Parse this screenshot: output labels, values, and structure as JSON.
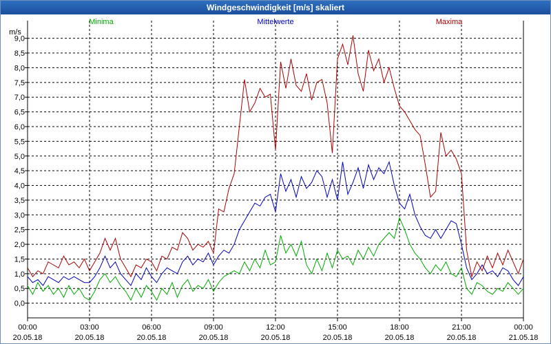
{
  "title": "Windgeschwindigkeit [m/s] skaliert",
  "chart_data": {
    "type": "line",
    "title": "Windgeschwindigkeit [m/s] skaliert",
    "ylabel": "m/s",
    "xlabel": "",
    "ylim": [
      -0.5,
      9.6
    ],
    "xlim": [
      0,
      24
    ],
    "grid": true,
    "legend_position": "top",
    "yticks": [
      "0,0",
      "0,5",
      "1,0",
      "1,5",
      "2,0",
      "2,5",
      "3,0",
      "3,5",
      "4,0",
      "4,5",
      "5,0",
      "5,5",
      "6,0",
      "6,5",
      "7,0",
      "7,5",
      "8,0",
      "8,5",
      "9,0"
    ],
    "xticks": [
      {
        "time": "00:00",
        "date": "20.05.18"
      },
      {
        "time": "03:00",
        "date": "20.05.18"
      },
      {
        "time": "06:00",
        "date": "20.05.18"
      },
      {
        "time": "09:00",
        "date": "20.05.18"
      },
      {
        "time": "12:00",
        "date": "20.05.18"
      },
      {
        "time": "15:00",
        "date": "20.05.18"
      },
      {
        "time": "18:00",
        "date": "20.05.18"
      },
      {
        "time": "21:00",
        "date": "20.05.18"
      },
      {
        "time": "00:00",
        "date": "21.05.18"
      }
    ],
    "series": [
      {
        "name": "Minima",
        "color": "#00aa00",
        "x": [
          0,
          0.25,
          0.5,
          0.75,
          1,
          1.25,
          1.5,
          1.75,
          2,
          2.25,
          2.5,
          2.75,
          3,
          3.25,
          3.5,
          3.75,
          4,
          4.25,
          4.5,
          4.75,
          5,
          5.25,
          5.5,
          5.75,
          6,
          6.25,
          6.5,
          6.75,
          7,
          7.25,
          7.5,
          7.75,
          8,
          8.25,
          8.5,
          8.75,
          9,
          9.25,
          9.5,
          9.75,
          10,
          10.25,
          10.5,
          10.75,
          11,
          11.25,
          11.5,
          11.75,
          12,
          12.25,
          12.5,
          12.75,
          13,
          13.25,
          13.5,
          13.75,
          14,
          14.25,
          14.5,
          14.75,
          15,
          15.25,
          15.5,
          15.75,
          16,
          16.25,
          16.5,
          16.75,
          17,
          17.25,
          17.5,
          17.75,
          18,
          18.25,
          18.5,
          18.75,
          19,
          19.25,
          19.5,
          19.75,
          20,
          20.25,
          20.5,
          20.75,
          21,
          21.25,
          21.5,
          21.75,
          22,
          22.25,
          22.5,
          22.75,
          23,
          23.25,
          23.5,
          23.75,
          24
        ],
        "y": [
          0.6,
          0.3,
          0.7,
          0.4,
          0.6,
          0.3,
          0.5,
          0.2,
          0.6,
          0.3,
          0.5,
          0.2,
          0.1,
          0.4,
          0.8,
          1.0,
          0.7,
          0.9,
          0.6,
          0.4,
          0.1,
          0.5,
          0.2,
          0.6,
          0.4,
          0.1,
          0.5,
          0.3,
          0.7,
          0.2,
          0.6,
          0.8,
          0.4,
          0.6,
          0.5,
          0.8,
          0.4,
          0.7,
          0.9,
          1.0,
          1.1,
          1.0,
          1.4,
          1.1,
          1.5,
          1.2,
          1.8,
          1.3,
          1.4,
          2.3,
          1.7,
          2.0,
          1.6,
          2.1,
          1.3,
          1.0,
          1.5,
          1.1,
          1.7,
          1.2,
          1.8,
          1.5,
          1.6,
          1.3,
          1.8,
          1.5,
          1.9,
          1.6,
          2.0,
          2.2,
          2.4,
          2.2,
          2.9,
          2.5,
          2.0,
          1.7,
          1.5,
          1.2,
          1.0,
          1.3,
          1.1,
          1.4,
          1.0,
          0.9,
          1.2,
          0.5,
          0.3,
          0.7,
          0.6,
          0.4,
          0.3,
          0.5,
          0.4,
          0.7,
          0.5,
          0.3,
          0.5
        ]
      },
      {
        "name": "Mittelwerte",
        "color": "#0000bb",
        "x": [
          0,
          0.25,
          0.5,
          0.75,
          1,
          1.25,
          1.5,
          1.75,
          2,
          2.25,
          2.5,
          2.75,
          3,
          3.25,
          3.5,
          3.75,
          4,
          4.25,
          4.5,
          4.75,
          5,
          5.25,
          5.5,
          5.75,
          6,
          6.25,
          6.5,
          6.75,
          7,
          7.25,
          7.5,
          7.75,
          8,
          8.25,
          8.5,
          8.75,
          9,
          9.25,
          9.5,
          9.75,
          10,
          10.25,
          10.5,
          10.75,
          11,
          11.25,
          11.5,
          11.75,
          12,
          12.25,
          12.5,
          12.75,
          13,
          13.25,
          13.5,
          13.75,
          14,
          14.25,
          14.5,
          14.75,
          15,
          15.25,
          15.5,
          15.75,
          16,
          16.25,
          16.5,
          16.75,
          17,
          17.25,
          17.5,
          17.75,
          18,
          18.25,
          18.5,
          18.75,
          19,
          19.25,
          19.5,
          19.75,
          20,
          20.25,
          20.5,
          20.75,
          21,
          21.25,
          21.5,
          21.75,
          22,
          22.25,
          22.5,
          22.75,
          23,
          23.25,
          23.5,
          23.75,
          24
        ],
        "y": [
          0.9,
          0.7,
          0.8,
          0.6,
          0.9,
          0.8,
          0.7,
          0.9,
          0.8,
          0.9,
          0.8,
          0.7,
          0.7,
          0.9,
          1.2,
          1.6,
          1.2,
          1.4,
          1.0,
          0.8,
          0.6,
          1.0,
          0.8,
          1.2,
          0.9,
          0.7,
          1.0,
          1.2,
          1.1,
          1.0,
          1.4,
          1.6,
          1.3,
          1.5,
          1.4,
          1.7,
          1.3,
          1.6,
          1.8,
          1.7,
          2.0,
          2.5,
          2.8,
          3.1,
          3.4,
          3.3,
          3.6,
          3.7,
          3.1,
          4.4,
          3.8,
          4.2,
          3.6,
          4.3,
          3.9,
          4.1,
          4.5,
          4.3,
          3.6,
          4.2,
          3.5,
          4.8,
          3.7,
          4.1,
          4.6,
          3.9,
          4.7,
          4.2,
          4.6,
          4.4,
          4.8,
          4.0,
          3.4,
          3.2,
          3.7,
          3.0,
          2.6,
          2.3,
          2.2,
          2.5,
          2.2,
          2.5,
          2.8,
          2.7,
          2.0,
          1.2,
          0.8,
          1.0,
          1.3,
          1.0,
          1.1,
          0.9,
          1.2,
          1.1,
          0.8,
          0.6,
          0.9
        ]
      },
      {
        "name": "Maxima",
        "color": "#aa0000",
        "x": [
          0,
          0.25,
          0.5,
          0.75,
          1,
          1.25,
          1.5,
          1.75,
          2,
          2.25,
          2.5,
          2.75,
          3,
          3.25,
          3.5,
          3.75,
          4,
          4.25,
          4.5,
          4.75,
          5,
          5.25,
          5.5,
          5.75,
          6,
          6.25,
          6.5,
          6.75,
          7,
          7.25,
          7.5,
          7.75,
          8,
          8.25,
          8.5,
          8.75,
          9,
          9.25,
          9.5,
          9.75,
          10,
          10.25,
          10.5,
          10.75,
          11,
          11.25,
          11.5,
          11.75,
          12,
          12.25,
          12.5,
          12.75,
          13,
          13.25,
          13.5,
          13.75,
          14,
          14.25,
          14.5,
          14.75,
          15,
          15.25,
          15.5,
          15.75,
          16,
          16.25,
          16.5,
          16.75,
          17,
          17.25,
          17.5,
          17.75,
          18,
          18.25,
          18.5,
          18.75,
          19,
          19.25,
          19.5,
          19.75,
          20,
          20.25,
          20.5,
          20.75,
          21,
          21.25,
          21.5,
          21.75,
          22,
          22.25,
          22.5,
          22.75,
          23,
          23.25,
          23.5,
          23.75,
          24
        ],
        "y": [
          1.2,
          0.9,
          1.1,
          1.0,
          1.4,
          1.3,
          1.2,
          1.6,
          1.3,
          1.4,
          1.2,
          1.5,
          1.1,
          1.4,
          1.7,
          2.2,
          1.8,
          2.2,
          1.5,
          1.2,
          0.9,
          1.3,
          1.2,
          1.5,
          1.4,
          1.1,
          1.6,
          1.5,
          1.9,
          1.8,
          2.4,
          2.2,
          1.8,
          2.0,
          1.9,
          2.1,
          1.7,
          3.2,
          3.1,
          3.9,
          4.4,
          6.0,
          7.6,
          6.5,
          6.8,
          7.3,
          7.0,
          7.1,
          5.2,
          8.2,
          7.3,
          8.3,
          7.4,
          7.2,
          7.8,
          6.9,
          7.5,
          7.6,
          6.8,
          5.1,
          8.3,
          8.8,
          8.1,
          9.1,
          7.8,
          7.2,
          8.6,
          7.9,
          8.3,
          7.5,
          8.0,
          7.3,
          6.7,
          6.5,
          6.2,
          5.9,
          5.7,
          4.7,
          3.6,
          3.8,
          5.8,
          5.0,
          5.2,
          4.9,
          4.4,
          1.8,
          0.9,
          1.4,
          1.1,
          1.6,
          1.2,
          1.7,
          1.3,
          1.8,
          1.4,
          1.0,
          1.5
        ]
      }
    ]
  }
}
